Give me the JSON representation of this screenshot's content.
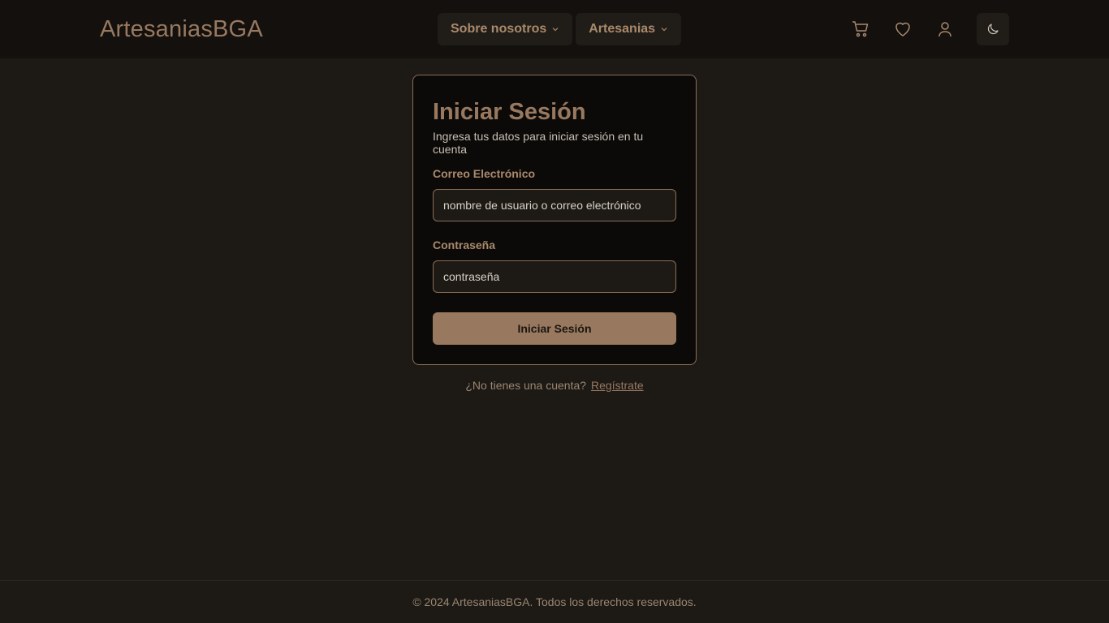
{
  "header": {
    "brand": "ArtesaniasBGA",
    "nav": [
      {
        "label": "Sobre nosotros"
      },
      {
        "label": "Artesanias"
      }
    ],
    "icons": [
      "cart-icon",
      "heart-icon",
      "user-icon",
      "moon-icon"
    ]
  },
  "login": {
    "title": "Iniciar Sesión",
    "subtitle": "Ingresa tus datos para iniciar sesión en tu cuenta",
    "email_label": "Correo Electrónico",
    "email_placeholder": "nombre de usuario o correo electrónico",
    "password_label": "Contraseña",
    "password_placeholder": "contraseña",
    "submit_label": "Iniciar Sesión"
  },
  "signup": {
    "prompt": "¿No tienes una cuenta?",
    "link": "Regístrate"
  },
  "footer": {
    "text": "© 2024 ArtesaniasBGA. Todos los derechos reservados."
  },
  "colors": {
    "accent": "#98795f",
    "background": "#1d1a16",
    "header_bg": "#13100e",
    "card_bg": "#0c0a09"
  }
}
